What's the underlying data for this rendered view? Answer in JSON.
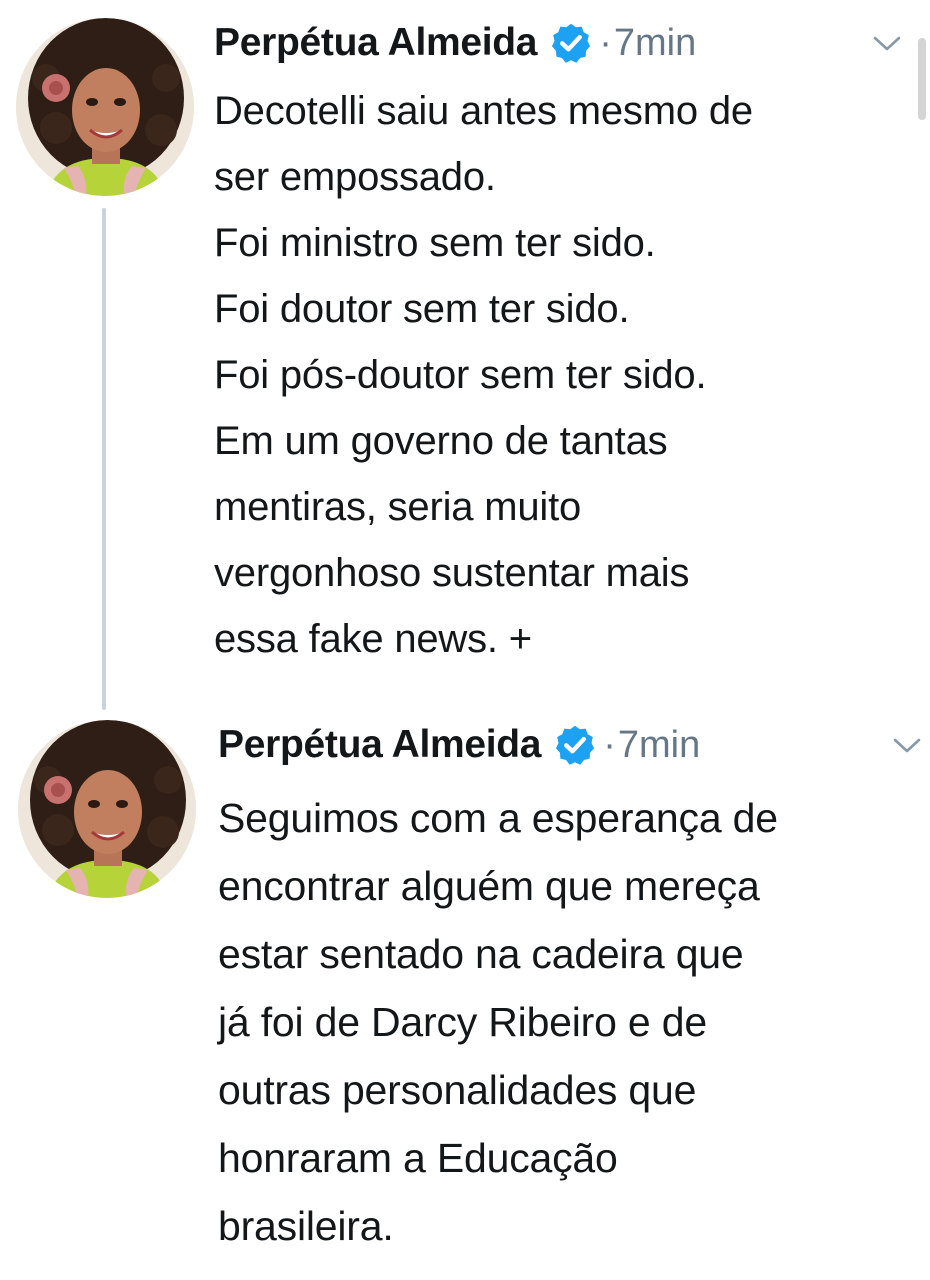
{
  "colors": {
    "text": "#14171a",
    "secondary": "#657786",
    "verified_blue": "#1da1f2",
    "thread_line": "#c9d3dc"
  },
  "tweets": [
    {
      "author_name": "Perpétua Almeida",
      "separator": "·",
      "time": "7min",
      "verified_icon": "verified-badge-icon",
      "menu_icon": "chevron-down-icon",
      "lines": [
        "Decotelli saiu antes mesmo de",
        "ser empossado.",
        "Foi ministro sem ter sido.",
        "Foi doutor sem ter sido.",
        "Foi pós-doutor sem ter sido.",
        "Em um governo de tantas",
        "mentiras, seria muito",
        "vergonhoso sustentar mais",
        "essa fake news. +"
      ]
    },
    {
      "author_name": "Perpétua Almeida",
      "separator": "·",
      "time": "7min",
      "verified_icon": "verified-badge-icon",
      "menu_icon": "chevron-down-icon",
      "lines": [
        "Seguimos com a esperança de",
        "encontrar alguém que mereça",
        "estar sentado na cadeira que",
        "já foi de Darcy Ribeiro e de",
        "outras personalidades que",
        "honraram a Educação",
        "brasileira."
      ]
    }
  ]
}
